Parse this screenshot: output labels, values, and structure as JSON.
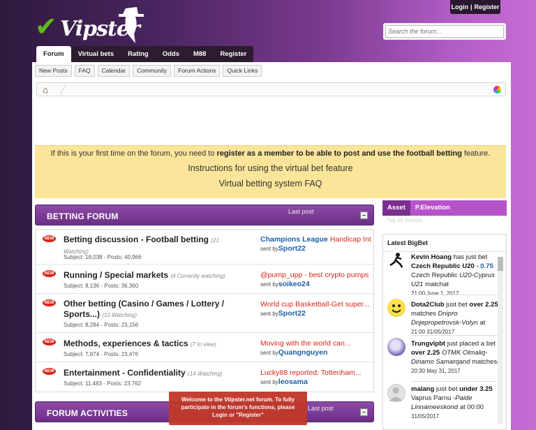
{
  "header": {
    "logo_text": "Vipster",
    "auth": {
      "login": "Login",
      "sep": "|",
      "register": "Register"
    },
    "search_placeholder": "Search the forum..."
  },
  "nav": {
    "tabs": [
      {
        "label": "Forum",
        "active": true
      },
      {
        "label": "Virtual bets"
      },
      {
        "label": "Rating"
      },
      {
        "label": "Odds"
      },
      {
        "label": "M88"
      },
      {
        "label": "Register"
      }
    ]
  },
  "subnav": [
    "New Posts",
    "FAQ",
    "Calendar",
    "Community",
    "Forum Actions",
    "Quick Links"
  ],
  "notice": {
    "pre": "If this is your first time on the forum, you need to ",
    "bold1": "register as a member to be able to post and use the football betting",
    "post": " feature.",
    "link1": "Instructions for using the virtual bet feature",
    "link2": "Virtual betting system FAQ"
  },
  "betting_forum": {
    "title": "BETTING FORUM",
    "last_post_label": "Last post",
    "rows": [
      {
        "name": "Betting discussion - Football betting",
        "watch": "(21 Watching)",
        "stats": "Subject: 18,038 - Posts: 40,966",
        "last_blue": "Champions League",
        "last_red": " Handicap Int",
        "sent_prefix": "sent by",
        "sent_by": "Sport22"
      },
      {
        "name": "Running / Special markets",
        "watch": "(4 Currently watching)",
        "stats": "Subject: 8,136 - Posts: 36,360",
        "last_red": "@pump_upp - best crypto pumps",
        "sent_prefix": "sent by",
        "sent_by": "soikeo24"
      },
      {
        "name": "Other betting (Casino / Games / Lottery / Sports...)",
        "watch": "(10 Watching)",
        "stats": "Subject: 8,284 - Posts: 23,156",
        "last_red": "World cup Basketball-Get super...",
        "sent_prefix": "sent by",
        "sent_by": "Sport22"
      },
      {
        "name": "Methods, experiences & tactics",
        "watch": "(7 In view)",
        "stats": "Subject: 7,874 - Posts: 23,476",
        "last_red": "Moving with the world can...",
        "sent_prefix": "sent by",
        "sent_by": "Quangnguyen"
      },
      {
        "name": "Entertainment - Confidentiality",
        "watch": "(14 Watching)",
        "stats": "Subject: 11,483 - Posts: 23.762",
        "last_red": "Lucky88 reported: Tottenham...",
        "sent_prefix": "sent by",
        "sent_by": "leosama"
      }
    ],
    "new_badge": "NEW"
  },
  "forum_activities": {
    "title": "FORUM ACTIVITIES",
    "last_post_label": "Last post"
  },
  "sidebar": {
    "tabs": [
      {
        "label": "Asset",
        "active": true
      },
      {
        "label": "P.Elevation"
      }
    ],
    "sub": "Top 10 bettors",
    "bigbet_title": "Latest BigBet",
    "bets": [
      {
        "user": "Kevin Hoang",
        "mid": " has just bet ",
        "team": "Czech Republic U20",
        "odds": "- 0.75",
        "odds_tail": " Czech Republic",
        "match": "U20-Cyprus U21",
        "match_tail": " matchat",
        "time": "21:00 June 1, 2017",
        "avatar": "soccer-player"
      },
      {
        "user": "Dota2Club",
        "mid": " just bet ",
        "team": "over",
        "odds": "2.25",
        "odds_tail": " matches ",
        "match": "Dnipro Dnjepropetrovsk-Volyn",
        "match_tail": " at",
        "time": "21:00 31/05/2017",
        "avatar": "smiley"
      },
      {
        "user": "Trungvipbt",
        "mid": " just placed a bet ",
        "team": "over 2.25",
        "odds": "",
        "odds_tail": " ",
        "match": "OTMK Olmaliq-Dinamo Samarqand",
        "match_tail": " matchesat",
        "time": "20:30 May 31, 2017",
        "avatar": "anime"
      },
      {
        "user": "malang",
        "mid": " just bet ",
        "team": "under",
        "odds": "3.25",
        "odds_tail": " Vaprus Parnu ",
        "match": "-Paide Linnameeskond",
        "match_tail": " at 00:00",
        "time": "31/05/2017",
        "avatar": "default-user"
      }
    ]
  },
  "toast": {
    "text1": "Welcome to the Vtipster.net forum. To fully participate in the forum's functions, please ",
    "login": "Login",
    "or": " or ",
    "register": "\"Register\""
  },
  "colors": {
    "purple_header": "#7a3a8e",
    "notice_bg": "#fae59a",
    "red_link": "#d8261a",
    "blue_link": "#1c5fa8",
    "toast_bg": "#c0392b"
  }
}
